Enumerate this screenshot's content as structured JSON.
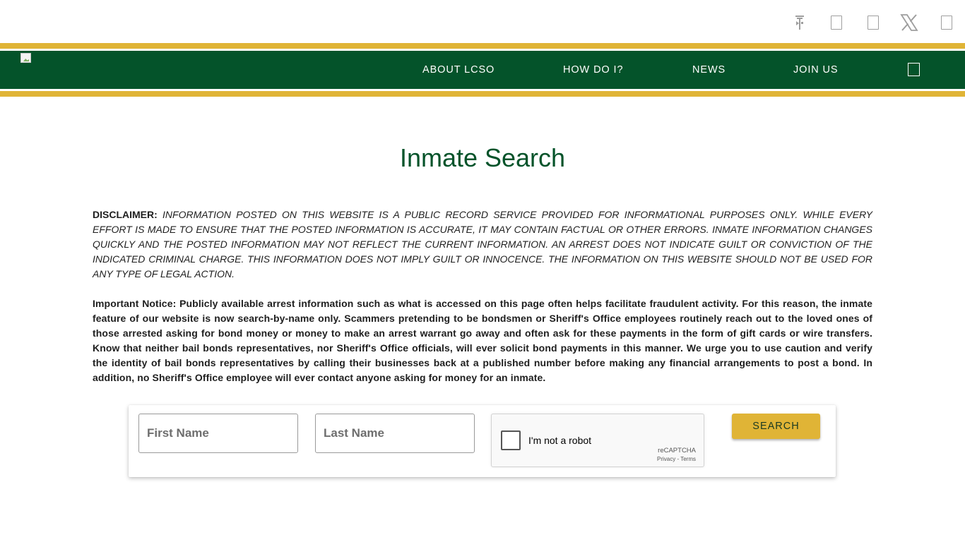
{
  "topbar": {
    "icons": [
      "sheriff-badge-icon",
      "facebook-icon",
      "instagram-icon",
      "x-twitter-icon",
      "youtube-icon"
    ]
  },
  "nav": {
    "items": [
      {
        "label": "ABOUT LCSO"
      },
      {
        "label": "HOW DO I?"
      },
      {
        "label": "NEWS"
      },
      {
        "label": "JOIN US"
      }
    ],
    "menu_icon": "menu-icon"
  },
  "page": {
    "title": "Inmate Search"
  },
  "disclaimer": {
    "label": "DISCLAIMER:",
    "text": "INFORMATION POSTED ON THIS WEBSITE IS A PUBLIC RECORD SERVICE PROVIDED FOR INFORMATIONAL PURPOSES ONLY. WHILE EVERY EFFORT IS MADE TO ENSURE THAT THE POSTED INFORMATION IS ACCURATE, IT MAY CONTAIN FACTUAL OR OTHER ERRORS. INMATE INFORMATION CHANGES QUICKLY AND THE POSTED INFORMATION MAY NOT REFLECT THE CURRENT INFORMATION. AN ARREST DOES NOT INDICATE GUILT OR CONVICTION OF THE INDICATED CRIMINAL CHARGE. THIS INFORMATION DOES NOT IMPLY GUILT OR INNOCENCE. THE INFORMATION ON THIS WEBSITE SHOULD NOT BE USED FOR ANY TYPE OF LEGAL ACTION."
  },
  "notice": {
    "text": "Important Notice: Publicly available arrest information such as what is accessed on this page often helps facilitate fraudulent activity. For this reason, the inmate feature of our website is now search-by-name only. Scammers pretending to be bondsmen or Sheriff's Office employees routinely reach out to the loved ones of those arrested asking for bond money or money to make an arrest warrant go away and often ask for these payments in the form of gift cards or wire transfers. Know that neither bail bonds representatives, nor Sheriff's Office officials, will ever solicit bond payments in this manner. We urge you to use caution and verify the identity of bail bonds representatives by calling their businesses back at a published number before making any financial arrangements to post a bond. In addition, no Sheriff's Office employee will ever contact anyone asking for money for an inmate."
  },
  "search": {
    "first_name": {
      "placeholder": "First Name",
      "value": ""
    },
    "last_name": {
      "placeholder": "Last Name",
      "value": ""
    },
    "captcha": {
      "label": "I'm not a robot",
      "brand": "reCAPTCHA",
      "privacy": "Privacy",
      "separator": " - ",
      "terms": "Terms",
      "checked": false
    },
    "button_label": "SEARCH"
  },
  "colors": {
    "brand_green": "#04532a",
    "brand_gold": "#e0b436",
    "icon_gray": "#9e9e9e"
  }
}
